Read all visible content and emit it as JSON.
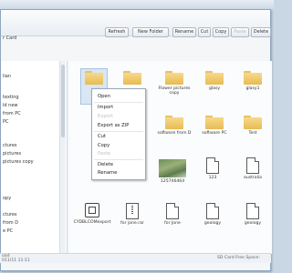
{
  "window": {
    "location_label": "r Card"
  },
  "toolbar": {
    "buttons": [
      {
        "label": "Refresh",
        "disabled": false
      },
      {
        "label": "New Folder",
        "disabled": false
      },
      {
        "label": "Rename",
        "disabled": false
      },
      {
        "label": "Cut",
        "disabled": false
      },
      {
        "label": "Copy",
        "disabled": false
      },
      {
        "label": "Paste",
        "disabled": true
      },
      {
        "label": "Delete",
        "disabled": false
      }
    ]
  },
  "sidebar": {
    "items": [
      "lian",
      "texting",
      "ld new",
      "from PC",
      "PC",
      "ctures",
      "pictures",
      "pictures copy",
      "opy",
      "ctures",
      "from D",
      "e PC"
    ]
  },
  "files": [
    {
      "name": "",
      "type": "folder"
    },
    {
      "name": "",
      "type": "folder"
    },
    {
      "name": "Flower pictures copy",
      "type": "folder"
    },
    {
      "name": "glasy",
      "type": "folder"
    },
    {
      "name": "glasy1",
      "type": "folder"
    },
    {
      "name": "software from D",
      "type": "folder"
    },
    {
      "name": "software PC",
      "type": "folder"
    },
    {
      "name": "Test",
      "type": "folder"
    },
    {
      "name": "125746464",
      "type": "image"
    },
    {
      "name": "123",
      "type": "document"
    },
    {
      "name": "australia",
      "type": "document"
    },
    {
      "name": "CYDBLCOMexport",
      "type": "app"
    },
    {
      "name": "for jone.rar",
      "type": "archive"
    },
    {
      "name": "for Jone",
      "type": "document"
    },
    {
      "name": "geology",
      "type": "document"
    },
    {
      "name": "geology",
      "type": "document"
    }
  ],
  "context_menu": {
    "items": [
      {
        "label": "Open",
        "disabled": false
      },
      {
        "label": "Import",
        "disabled": false
      },
      {
        "label": "Export",
        "disabled": true
      },
      {
        "label": "Export as ZIP",
        "disabled": false
      },
      {
        "label": "Cut",
        "disabled": false
      },
      {
        "label": "Copy",
        "disabled": false
      },
      {
        "label": "Paste",
        "disabled": true
      },
      {
        "label": "Delete",
        "disabled": false
      },
      {
        "label": "Rename",
        "disabled": false
      }
    ]
  },
  "status": {
    "left": "oad",
    "date": "011/11 11:11",
    "right": "SD Card Free Space:"
  }
}
